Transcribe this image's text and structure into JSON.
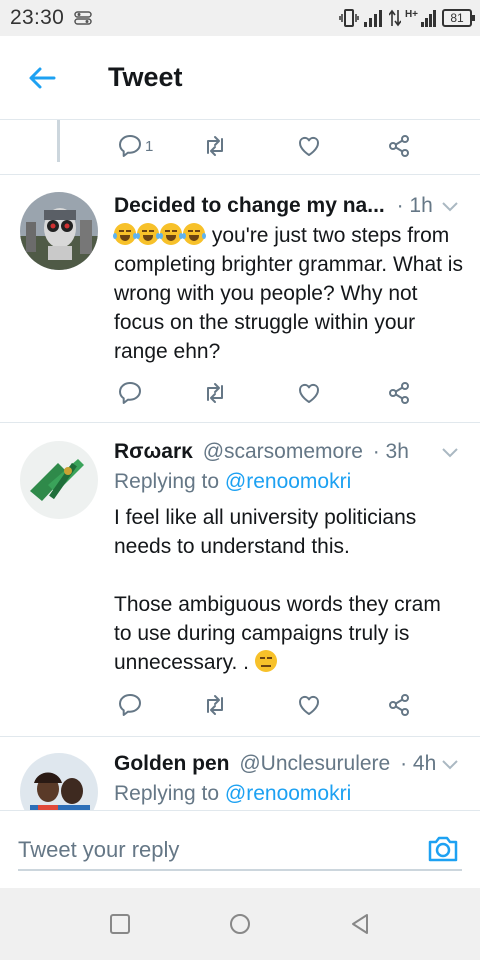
{
  "status_bar": {
    "time": "23:30",
    "network": "H+",
    "battery": "81"
  },
  "header": {
    "title": "Tweet",
    "back_icon": "arrow-left-icon"
  },
  "top_actions": {
    "reply_count": "1"
  },
  "tweets": [
    {
      "name": "Decided to change my na...",
      "handle": "",
      "time": "· 1h",
      "text": " you're just two steps from completing brighter grammar. What is wrong with you people? Why not focus on the struggle within your range ehn?",
      "emojis": [
        "rolling-laughing-emoji",
        "rolling-laughing-emoji",
        "rolling-laughing-emoji",
        "rolling-laughing-emoji"
      ]
    },
    {
      "name": "Rσωarκ",
      "handle": "@scarsomemore",
      "time": "· 3h",
      "replying_prefix": "Replying to ",
      "replying_to": "@renoomokri",
      "text": "I feel like all university politicians needs to understand this.\n\nThose ambiguous words they cram to use during campaigns truly is unnecessary. . ",
      "emojis": [
        "unamused-face-emoji"
      ]
    },
    {
      "name": "Golden pen",
      "handle": "@Unclesurulere",
      "time": "· 4h",
      "replying_prefix": "Replying to ",
      "replying_to": "@renoomokri"
    }
  ],
  "compose": {
    "placeholder": "Tweet your reply",
    "camera_icon": "camera-icon"
  },
  "navbar": {
    "icons": [
      "recents-square-icon",
      "home-circle-icon",
      "back-triangle-icon"
    ]
  },
  "colors": {
    "accent": "#1da1f2",
    "text": "#14171a",
    "secondary": "#657786",
    "divider": "#e1e8ed"
  }
}
